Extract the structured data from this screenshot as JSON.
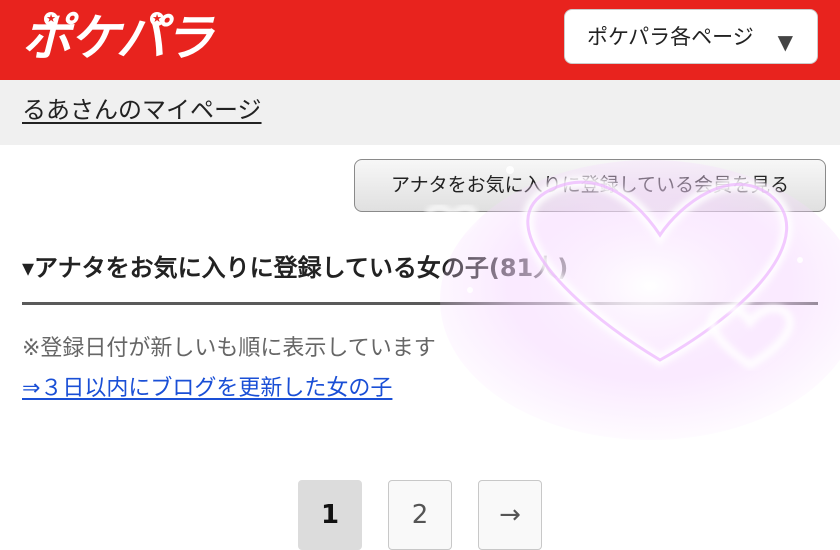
{
  "header": {
    "logo_text": "ポケパラ",
    "page_select_label": "ポケパラ各ページ",
    "brand_color": "#e8231e"
  },
  "subbar": {
    "mypage_title": "るあさんのマイページ"
  },
  "main": {
    "fav_button_label": "アナタをお気に入りに登録している会員を見る",
    "section_title": "▾アナタをお気に入りに登録している女の子(81人)",
    "note": "※登録日付が新しいも順に表示しています",
    "blog_link": "⇒３日以内にブログを更新した女の子"
  },
  "pagination": {
    "pages": [
      "1",
      "2"
    ],
    "current": "1",
    "next_label": "→"
  },
  "icons": {
    "select_arrow": "▼",
    "overlay": "heart-sparkle-overlay"
  }
}
